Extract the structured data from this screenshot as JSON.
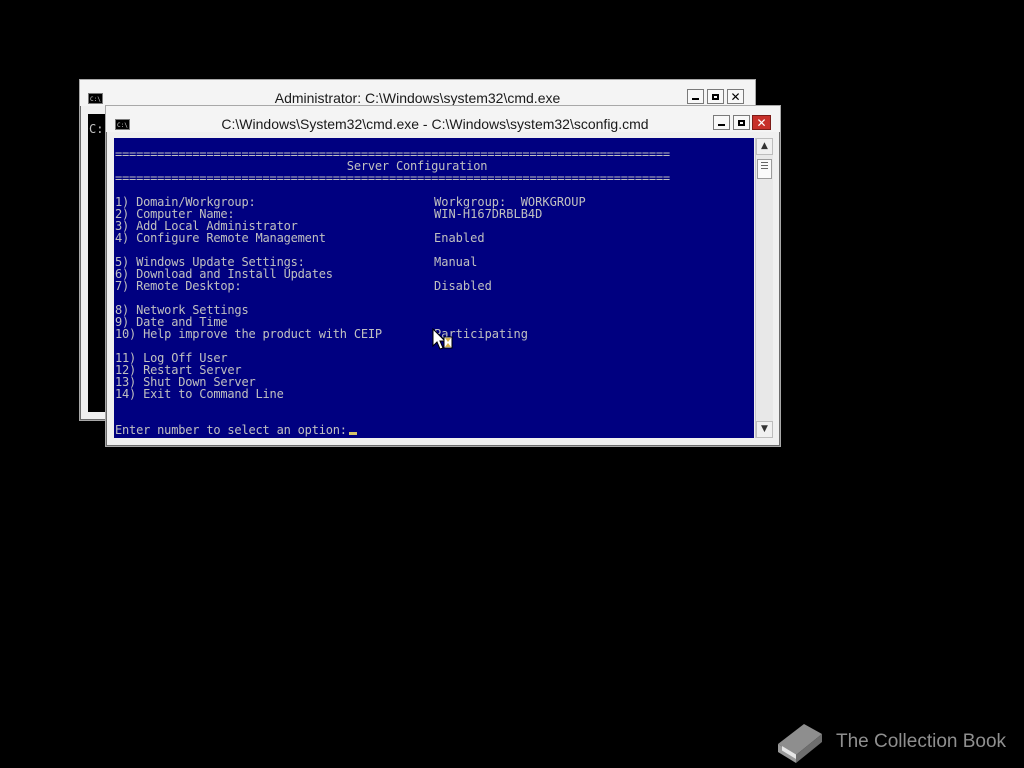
{
  "back_window": {
    "title": "Administrator: C:\\Windows\\system32\\cmd.exe",
    "console_text": "C:"
  },
  "front_window": {
    "title": "C:\\Windows\\System32\\cmd.exe - C:\\Windows\\system32\\sconfig.cmd",
    "separator": "===============================================================================",
    "heading": "                                 Server Configuration",
    "menu": [
      {
        "label": "1) Domain/Workgroup:",
        "value": "Workgroup:  WORKGROUP"
      },
      {
        "label": "2) Computer Name:",
        "value": "WIN-H167DRBLB4D"
      },
      {
        "label": "3) Add Local Administrator",
        "value": ""
      },
      {
        "label": "4) Configure Remote Management",
        "value": "Enabled"
      },
      {
        "label": "5) Windows Update Settings:",
        "value": "Manual"
      },
      {
        "label": "6) Download and Install Updates",
        "value": ""
      },
      {
        "label": "7) Remote Desktop:",
        "value": "Disabled"
      },
      {
        "label": "8) Network Settings",
        "value": ""
      },
      {
        "label": "9) Date and Time",
        "value": ""
      },
      {
        "label": "10) Help improve the product with CEIP",
        "value": "Participating"
      },
      {
        "label": "11) Log Off User",
        "value": ""
      },
      {
        "label": "12) Restart Server",
        "value": ""
      },
      {
        "label": "13) Shut Down Server",
        "value": ""
      },
      {
        "label": "14) Exit to Command Line",
        "value": ""
      }
    ],
    "prompt": "Enter number to select an option:"
  },
  "colors": {
    "console_bg": "#000080",
    "console_fg": "#c0c0c0",
    "caret": "#d4c36a",
    "close_button": "#c7302a"
  },
  "icons": {
    "window_icon": "cmd-icon",
    "minimize": "minimize-icon",
    "maximize": "maximize-icon",
    "close": "close-icon",
    "scroll_up": "chevron-up-icon",
    "scroll_down": "chevron-down-icon",
    "watermark": "book-icon"
  },
  "watermark": {
    "text": "The Collection Book"
  }
}
